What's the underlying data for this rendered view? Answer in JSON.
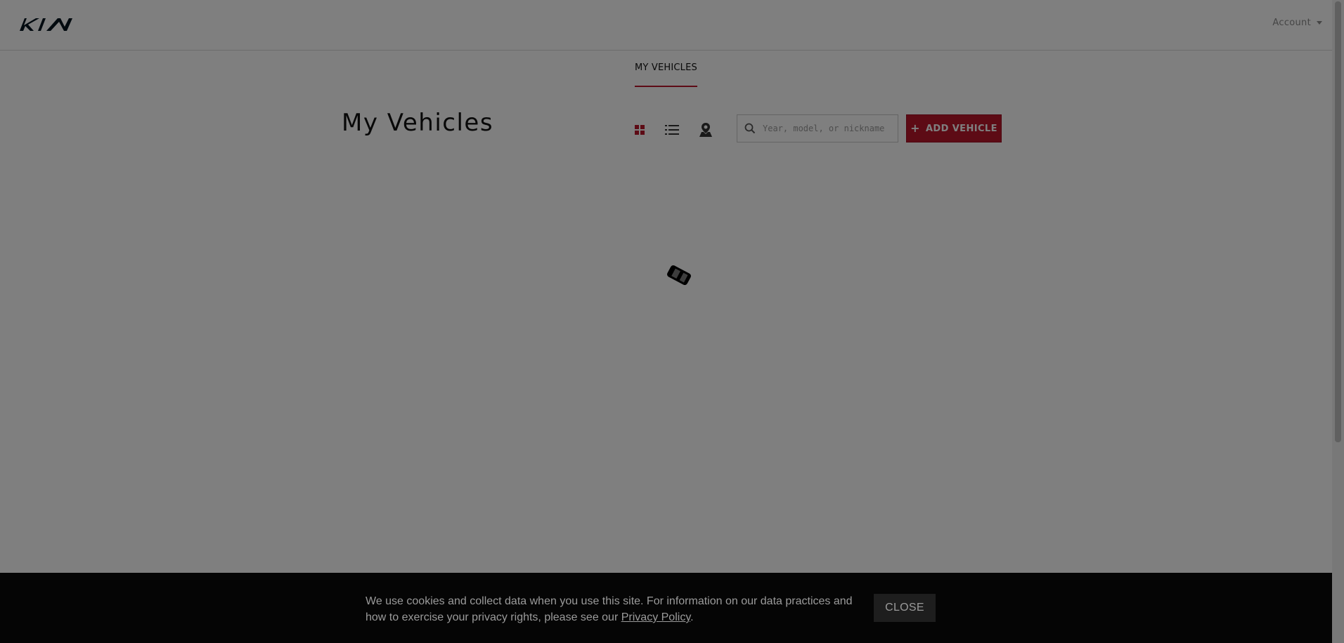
{
  "header": {
    "logo_icon": "kia-logo-icon",
    "account_label": "Account",
    "account_icon": "caret-down-icon"
  },
  "subnav": {
    "tabs": [
      {
        "label": "MY VEHICLES",
        "active": true
      }
    ]
  },
  "main": {
    "title": "My Vehicles",
    "view_toggles": [
      {
        "icon": "grid-view-icon",
        "active": true
      },
      {
        "icon": "list-view-icon",
        "active": false
      },
      {
        "icon": "map-pin-icon",
        "active": false
      }
    ],
    "search": {
      "placeholder": "Year, model, or nickname",
      "value": "",
      "icon": "search-icon"
    },
    "add_button": {
      "label": "ADD VEHICLE",
      "icon": "plus-icon"
    },
    "loader_icon": "car-loading-spinner-icon"
  },
  "cookie_banner": {
    "text_before": "We use cookies and collect data when you use this site. For information on our data practices and how to exercise your privacy rights, please see our ",
    "link_label": "Privacy Policy",
    "text_after": ".",
    "close_label": "CLOSE"
  },
  "colors": {
    "accent": "#bb162b",
    "overlay": "#000000",
    "banner_bg": "#050505",
    "text_dark": "#111111"
  }
}
